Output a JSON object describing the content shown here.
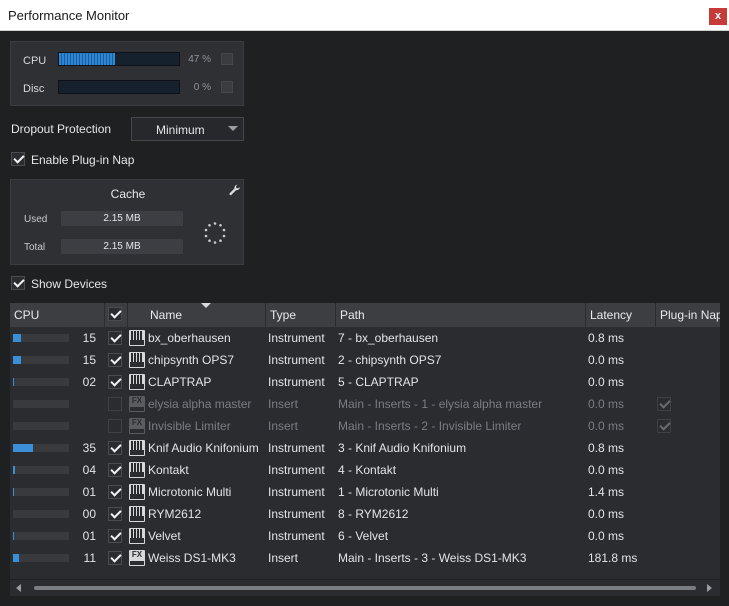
{
  "window": {
    "title": "Performance Monitor",
    "close_label": "x"
  },
  "meters": [
    {
      "label": "CPU",
      "percent_text": "47 %",
      "value": 0.47
    },
    {
      "label": "Disc",
      "percent_text": "0 %",
      "value": 0.0
    }
  ],
  "dropout": {
    "label": "Dropout Protection",
    "value": "Minimum"
  },
  "plugin_nap": {
    "label": "Enable Plug-in Nap",
    "checked": true
  },
  "cache": {
    "title": "Cache",
    "used_label": "Used",
    "used_value": "2.15 MB",
    "total_label": "Total",
    "total_value": "2.15 MB"
  },
  "show_devices": {
    "label": "Show Devices",
    "checked": true
  },
  "table": {
    "columns": {
      "cpu": "CPU",
      "name": "Name",
      "type": "Type",
      "path": "Path",
      "latency": "Latency",
      "plugin_nap": "Plug-in Nap"
    },
    "rows": [
      {
        "cpu_bar": 0.15,
        "cpu": "15",
        "enabled": true,
        "icon": "instrument",
        "name": "bx_oberhausen",
        "type": "Instrument",
        "path": "7 - bx_oberhausen",
        "latency": "0.8 ms",
        "nap": null,
        "dim": false
      },
      {
        "cpu_bar": 0.15,
        "cpu": "15",
        "enabled": true,
        "icon": "instrument",
        "name": "chipsynth OPS7",
        "type": "Instrument",
        "path": "2 - chipsynth OPS7",
        "latency": "0.0 ms",
        "nap": null,
        "dim": false
      },
      {
        "cpu_bar": 0.02,
        "cpu": "02",
        "enabled": true,
        "icon": "instrument",
        "name": "CLAPTRAP",
        "type": "Instrument",
        "path": "5 - CLAPTRAP",
        "latency": "0.0 ms",
        "nap": null,
        "dim": false
      },
      {
        "cpu_bar": 0,
        "cpu": "",
        "enabled": false,
        "icon": "fx",
        "name": "elysia alpha master",
        "type": "Insert",
        "path": "Main - Inserts - 1 - elysia alpha master",
        "latency": "0.0 ms",
        "nap": true,
        "dim": true
      },
      {
        "cpu_bar": 0,
        "cpu": "",
        "enabled": false,
        "icon": "fx",
        "name": "Invisible Limiter",
        "type": "Insert",
        "path": "Main - Inserts - 2 - Invisible Limiter",
        "latency": "0.0 ms",
        "nap": true,
        "dim": true
      },
      {
        "cpu_bar": 0.35,
        "cpu": "35",
        "enabled": true,
        "icon": "instrument",
        "name": "Knif Audio Knifonium",
        "type": "Instrument",
        "path": "3 - Knif Audio Knifonium",
        "latency": "0.8 ms",
        "nap": null,
        "dim": false
      },
      {
        "cpu_bar": 0.04,
        "cpu": "04",
        "enabled": true,
        "icon": "instrument",
        "name": "Kontakt",
        "type": "Instrument",
        "path": "4 - Kontakt",
        "latency": "0.0 ms",
        "nap": null,
        "dim": false
      },
      {
        "cpu_bar": 0.01,
        "cpu": "01",
        "enabled": true,
        "icon": "instrument",
        "name": "Microtonic Multi",
        "type": "Instrument",
        "path": "1 - Microtonic Multi",
        "latency": "1.4 ms",
        "nap": null,
        "dim": false
      },
      {
        "cpu_bar": 0.0,
        "cpu": "00",
        "enabled": true,
        "icon": "instrument",
        "name": "RYM2612",
        "type": "Instrument",
        "path": "8 - RYM2612",
        "latency": "0.0 ms",
        "nap": null,
        "dim": false
      },
      {
        "cpu_bar": 0.01,
        "cpu": "01",
        "enabled": true,
        "icon": "instrument",
        "name": "Velvet",
        "type": "Instrument",
        "path": "6 - Velvet",
        "latency": "0.0 ms",
        "nap": null,
        "dim": false
      },
      {
        "cpu_bar": 0.11,
        "cpu": "11",
        "enabled": true,
        "icon": "fx",
        "name": "Weiss DS1-MK3",
        "type": "Insert",
        "path": "Main - Inserts - 3 - Weiss DS1-MK3",
        "latency": "181.8 ms",
        "nap": null,
        "dim": false
      }
    ]
  },
  "colors": {
    "accent": "#3a8fd8",
    "close": "#c73a3a",
    "background": "#1f2022"
  }
}
